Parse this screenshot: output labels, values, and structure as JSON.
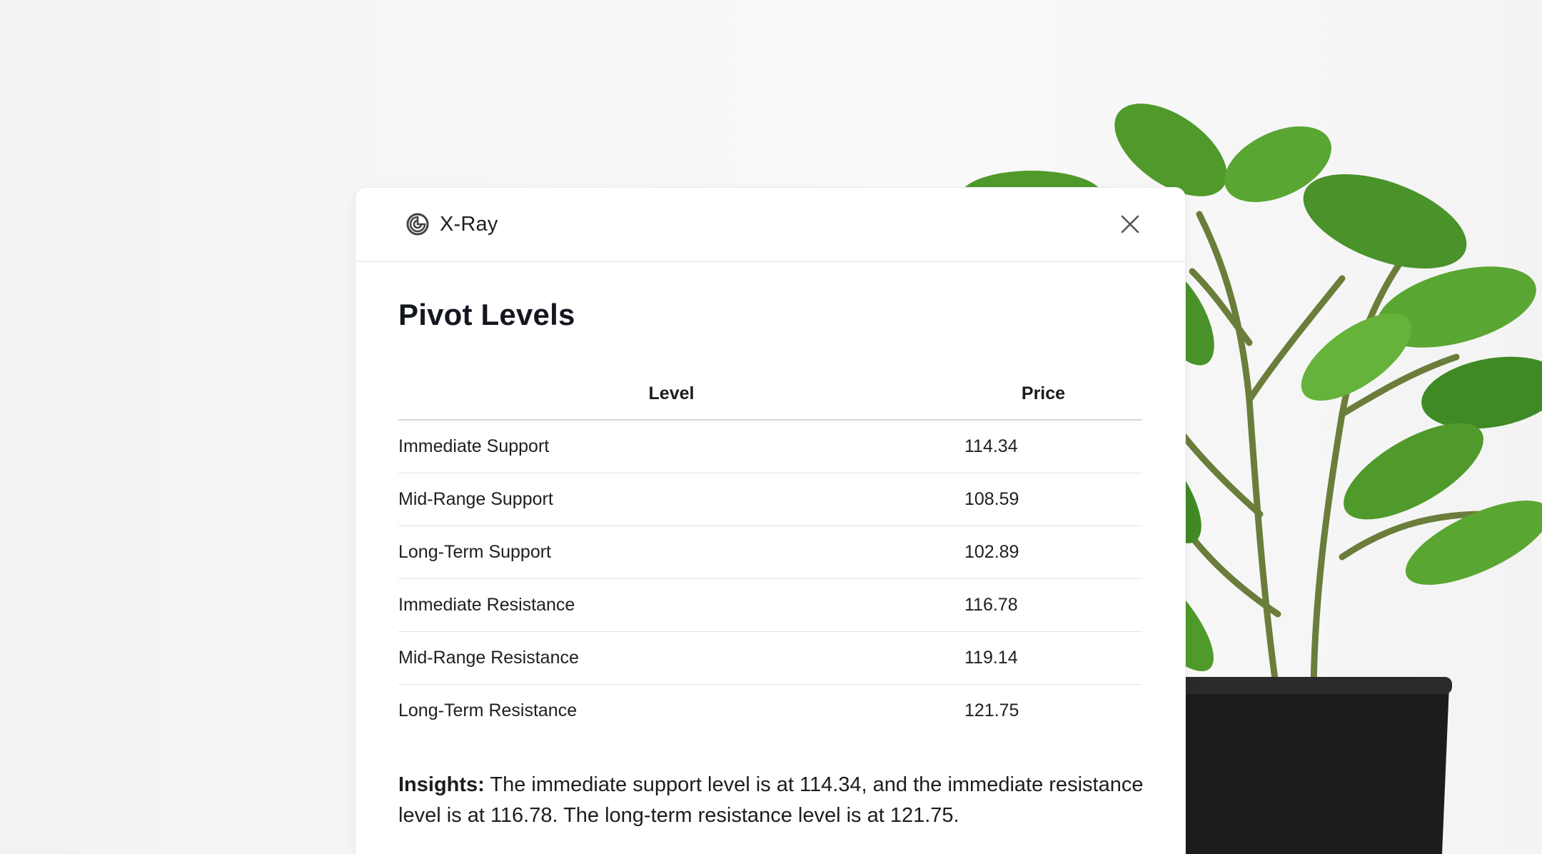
{
  "app": {
    "title": "X-Ray"
  },
  "section": {
    "title": "Pivot Levels"
  },
  "table": {
    "headers": [
      "Level",
      "Price"
    ],
    "rows": [
      {
        "level": "Immediate Support",
        "price": "114.34"
      },
      {
        "level": "Mid-Range Support",
        "price": "108.59"
      },
      {
        "level": "Long-Term Support",
        "price": "102.89"
      },
      {
        "level": "Immediate Resistance",
        "price": "116.78"
      },
      {
        "level": "Mid-Range Resistance",
        "price": "119.14"
      },
      {
        "level": "Long-Term Resistance",
        "price": "121.75"
      }
    ]
  },
  "insights": {
    "label": "Insights:",
    "text": "The immediate support level is at 114.34, and the immediate resistance level is at 116.78. The long-term resistance level is at 121.75."
  },
  "icons": {
    "brand": "xray-logo-icon",
    "close": "close-icon"
  },
  "colors": {
    "text": "#14171f",
    "divider": "#e2e2e2",
    "leaf": "#4f9a2a",
    "pot": "#1c1c1e"
  }
}
